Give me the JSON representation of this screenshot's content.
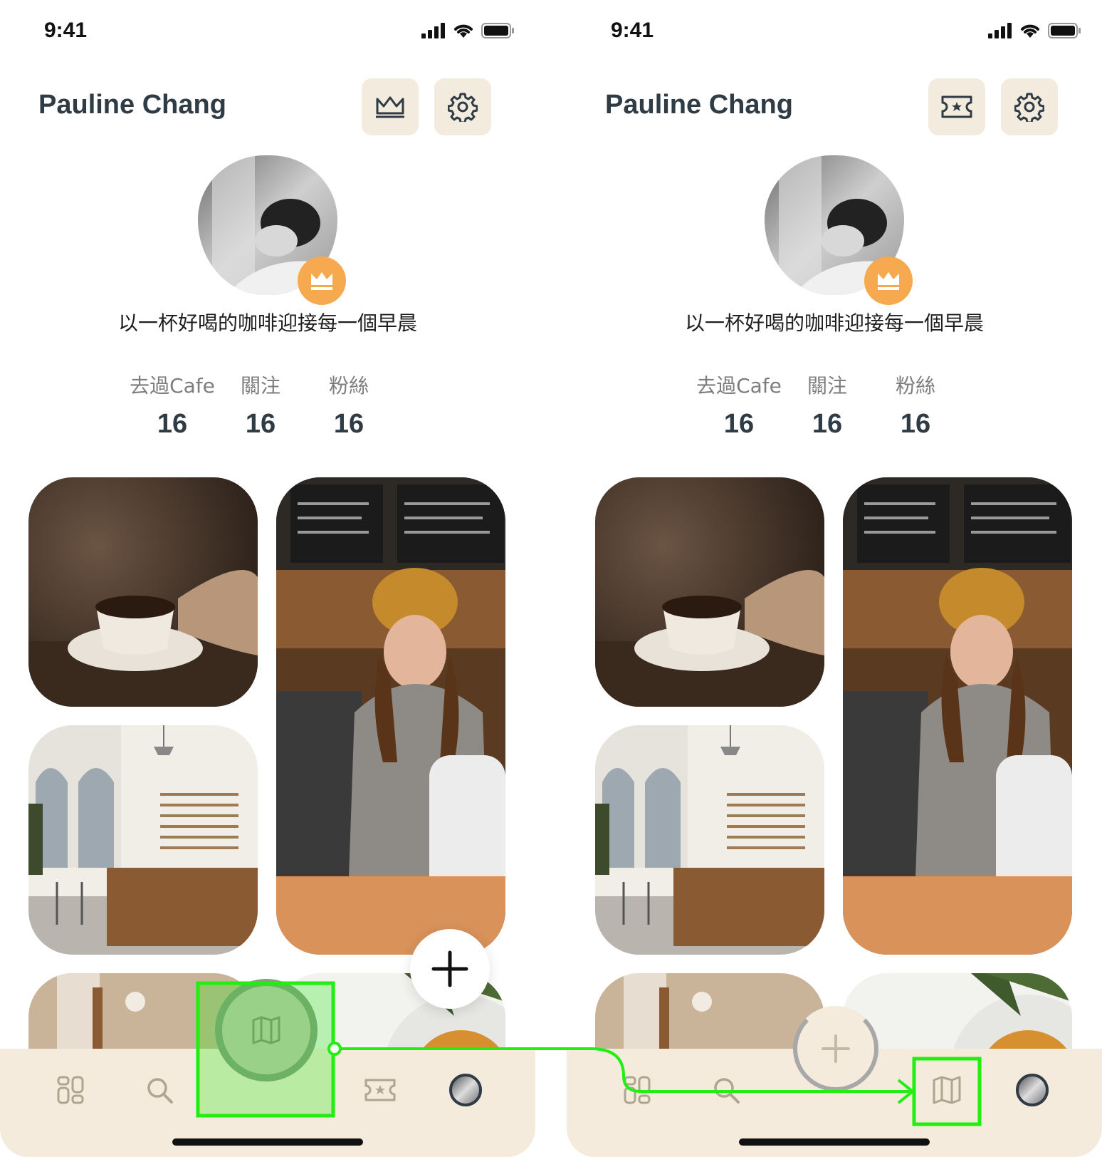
{
  "status_bar": {
    "time": "9:41"
  },
  "profile": {
    "name": "Pauline Chang",
    "bio": "以一杯好喝的咖啡迎接每一個早晨",
    "stats": [
      {
        "label": "去過Cafe",
        "value": "16"
      },
      {
        "label": "關注",
        "value": "16"
      },
      {
        "label": "粉絲",
        "value": "16"
      }
    ]
  },
  "left_screen": {
    "header_buttons": [
      "crown-icon",
      "gear-icon"
    ],
    "tabs": [
      "grid-icon",
      "search-icon",
      "map-icon",
      "ticket-star-icon",
      "avatar"
    ]
  },
  "right_screen": {
    "header_buttons": [
      "ticket-star-icon",
      "gear-icon"
    ],
    "tabs": [
      "grid-icon",
      "search-icon",
      "map-icon",
      "avatar"
    ]
  },
  "colors": {
    "accent_orange": "#f6a94f",
    "cream": "#f3ebde",
    "text_dark": "#2f3b45",
    "annotation_green": "#22ee11"
  }
}
